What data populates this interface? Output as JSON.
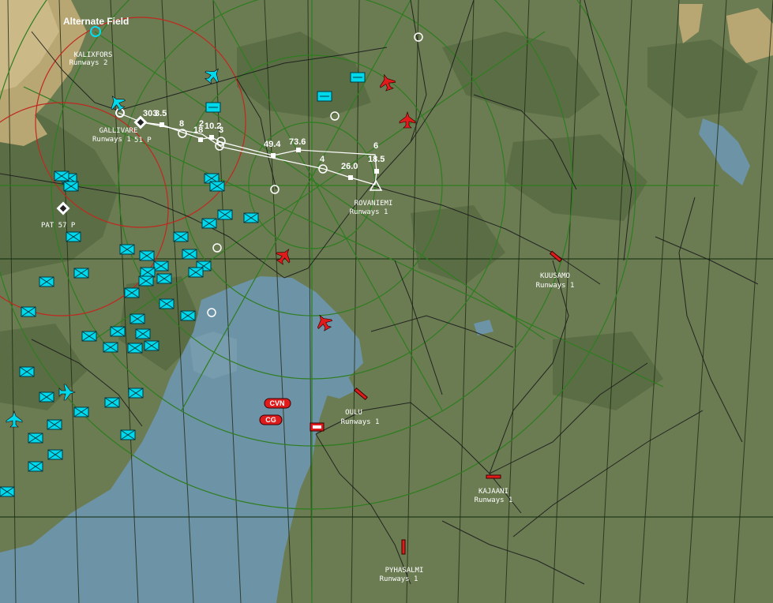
{
  "map": {
    "alternate_field": "Alternate Field",
    "colors": {
      "land": "#6b7b52",
      "land_dark": "#56693f",
      "land_light": "#7c8a60",
      "water": "#6d93a6",
      "terrain_high": "#b9a773",
      "grid": "#2e7d1f",
      "range_ring": "#c0281f",
      "friendly": "#00e0f0",
      "enemy": "#e01b1b",
      "road": "#1b1b1b",
      "route": "#ffffff"
    }
  },
  "airbases": [
    {
      "id": "kalixfors",
      "name": "KALIXFORS",
      "runways": "Runways 2",
      "side": "friendly"
    },
    {
      "id": "gallivare",
      "name": "GALLIVARE",
      "runways": "Runways 1",
      "side": "friendly"
    },
    {
      "id": "rovaniemi",
      "name": "ROVANIEMI",
      "runways": "Runways 1",
      "side": "target"
    },
    {
      "id": "kuusamo",
      "name": "KUUSAMO",
      "runways": "Runways 1",
      "side": "enemy"
    },
    {
      "id": "oulu",
      "name": "OULU",
      "runways": "Runways 1",
      "side": "enemy"
    },
    {
      "id": "kajaani",
      "name": "KAJAANI",
      "runways": "Runways 1",
      "side": "enemy"
    },
    {
      "id": "pyhasalmi",
      "name": "PYHASALMI",
      "runways": "Runways 1",
      "side": "enemy"
    }
  ],
  "route_labels": {
    "gallivare_suffix": "51  P",
    "pat": "PAT 57    P",
    "legs": [
      "303",
      "3.5",
      "8",
      "2",
      "10.2",
      "18",
      "3",
      "49.4",
      "73.6",
      "4",
      "26.0",
      "6",
      "18.5"
    ]
  },
  "ships": [
    "CVN",
    "CG"
  ]
}
